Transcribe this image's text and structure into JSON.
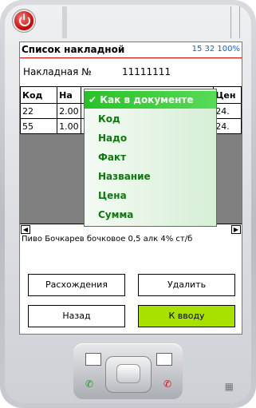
{
  "window": {
    "title": "Список накладной",
    "status": "15 32 100%"
  },
  "invoice": {
    "label": "Накладная №",
    "number": "11111111"
  },
  "table": {
    "columns": [
      "Код",
      "На",
      "Цен"
    ],
    "rows": [
      {
        "code": "22",
        "qty": "2.00",
        "price": "24."
      },
      {
        "code": "55",
        "qty": "1.00",
        "price": "24."
      }
    ]
  },
  "sort_menu": {
    "items": [
      {
        "label": "Как в документе",
        "selected": true
      },
      {
        "label": "Код",
        "selected": false
      },
      {
        "label": "Надо",
        "selected": false
      },
      {
        "label": "Факт",
        "selected": false
      },
      {
        "label": "Название",
        "selected": false
      },
      {
        "label": "Цена",
        "selected": false
      },
      {
        "label": "Сумма",
        "selected": false
      }
    ],
    "check_glyph": "✔"
  },
  "item_description": "Пиво Бочкарев бочковое 0,5 алк 4% ст/б",
  "buttons": {
    "discrepancies": "Расхождения",
    "delete": "Удалить",
    "back": "Назад",
    "to_input": "К вводу"
  },
  "colors": {
    "accent_green": "#a8e000",
    "menu_text": "#0a7a0a",
    "title_line": "#d00000",
    "clock": "#1060d0"
  },
  "icons": {
    "power": "power-icon",
    "call": "call-icon",
    "end_call": "end-call-icon",
    "windows": "windows-logo-icon"
  }
}
